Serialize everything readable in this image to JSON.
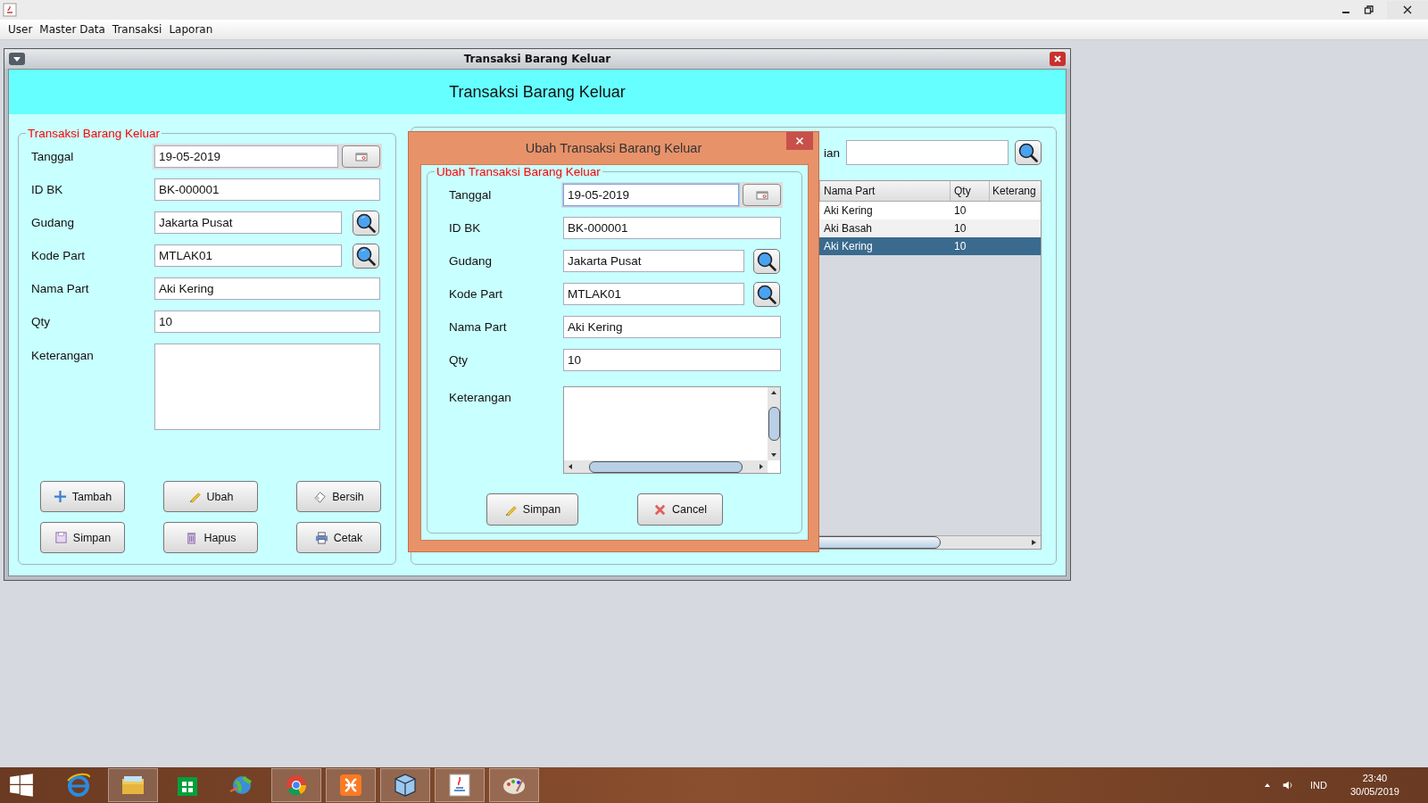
{
  "app_window": {
    "menu": [
      "User",
      "Master Data",
      "Transaksi",
      "Laporan"
    ]
  },
  "internal_frame": {
    "title": "Transaksi Barang Keluar",
    "header": "Transaksi Barang Keluar"
  },
  "form": {
    "legend": "Transaksi Barang Keluar",
    "fields": [
      {
        "label": "Tanggal",
        "value": "19-05-2019",
        "kind": "date"
      },
      {
        "label": "ID BK",
        "value": "BK-000001",
        "kind": "text"
      },
      {
        "label": "Gudang",
        "value": "Jakarta Pusat",
        "kind": "lookup"
      },
      {
        "label": "Kode Part",
        "value": "MTLAK01",
        "kind": "lookup"
      },
      {
        "label": "Nama Part",
        "value": "Aki Kering",
        "kind": "text"
      },
      {
        "label": "Qty",
        "value": "10",
        "kind": "text"
      },
      {
        "label": "Keterangan",
        "kind": "textarea"
      }
    ],
    "buttons": [
      {
        "label": "Tambah",
        "kind": "plus"
      },
      {
        "label": "Ubah",
        "kind": "pencil"
      },
      {
        "label": "Bersih",
        "kind": "eraser"
      },
      {
        "label": "Simpan",
        "kind": "disk"
      },
      {
        "label": "Hapus",
        "kind": "trash"
      },
      {
        "label": "Cetak",
        "kind": "printer"
      }
    ]
  },
  "table_panel": {
    "search_label": "ian",
    "columns": [
      "Nama Part",
      "Qty",
      "Keterang"
    ],
    "rows": [
      {
        "cells": [
          "Aki Kering",
          "10"
        ],
        "selected": false
      },
      {
        "cells": [
          "Aki Basah",
          "10"
        ],
        "selected": false
      },
      {
        "cells": [
          "Aki Kering",
          "10"
        ],
        "selected": true
      }
    ]
  },
  "dialog": {
    "title": "Ubah Transaksi Barang Keluar",
    "legend": "Ubah Transaksi Barang Keluar",
    "fields": [
      {
        "label": "Tanggal",
        "value": "19-05-2019",
        "kind": "date",
        "focused": true
      },
      {
        "label": "ID BK",
        "value": "BK-000001",
        "kind": "text",
        "focused": false
      },
      {
        "label": "Gudang",
        "value": "Jakarta Pusat",
        "kind": "lookup",
        "focused": false
      },
      {
        "label": "Kode Part",
        "value": "MTLAK01",
        "kind": "lookup",
        "focused": false
      },
      {
        "label": "Nama Part",
        "value": "Aki Kering",
        "kind": "text",
        "focused": false
      },
      {
        "label": "Qty",
        "value": "10",
        "kind": "text",
        "focused": false
      },
      {
        "label": "Keterangan",
        "kind": "textarea",
        "focused": false
      }
    ],
    "buttons": [
      {
        "label": "Simpan",
        "kind": "pencil"
      },
      {
        "label": "Cancel",
        "kind": "cross"
      }
    ]
  },
  "taskbar": {
    "apps": [
      {
        "kind": "browser",
        "running": false
      },
      {
        "kind": "folder",
        "running": true
      },
      {
        "kind": "store",
        "running": false
      },
      {
        "kind": "globe",
        "running": false
      },
      {
        "kind": "chrome",
        "running": true
      },
      {
        "kind": "xampp",
        "running": true
      },
      {
        "kind": "cube",
        "running": true
      },
      {
        "kind": "java",
        "running": true
      },
      {
        "kind": "palette",
        "running": true
      }
    ],
    "language": "IND",
    "time": "23:40",
    "date": "30/05/2019"
  }
}
